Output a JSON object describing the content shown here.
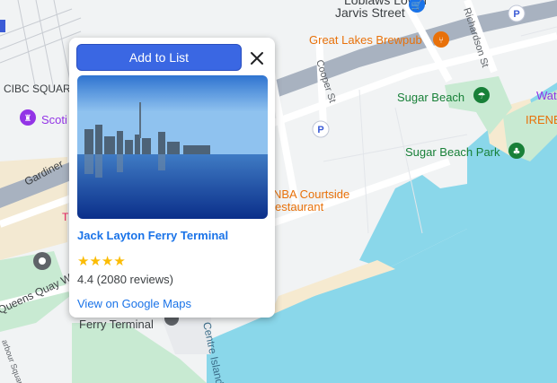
{
  "map": {
    "labels": {
      "loblaws": "Loblaws Lower",
      "jarvis": "Jarvis Street",
      "great_lakes": "Great Lakes Brewpub",
      "richardson": "Richardson St",
      "cooper": "Cooper St",
      "sugar_beach": "Sugar Beach",
      "sugar_beach_park": "Sugar Beach Park",
      "wat": "Wat",
      "irene": "IRENE",
      "cibc": "CIBC SQUAR",
      "scoti": "Scoti",
      "gardiner": "Gardiner",
      "courtside_1": "NBA Courtside",
      "courtside_2": "estaurant",
      "queens_quay": "Queens Quay W",
      "ferry_terminal": "Ferry Terminal",
      "centre_island": "Centre Island",
      "harbour_sq": "arbour Square",
      "t_letter": "T",
      "parking": "P"
    },
    "colors": {
      "water": "#8ad7ea",
      "land": "#f1f3f4",
      "road": "#ffffff",
      "highway": "#a8b2c0",
      "park": "#c8ead2",
      "sand": "#f6ead0",
      "poi_orange": "#e8710a",
      "poi_green": "#188038",
      "poi_purple": "#9334e6",
      "transit_label": "#3c4043"
    },
    "icons": [
      "shopping-cart-icon",
      "restaurant-icon",
      "beach-icon",
      "park-icon",
      "attraction-icon",
      "parking-icon",
      "ferry-pin-icon",
      "train-icon"
    ]
  },
  "popup": {
    "add_button": "Add to List",
    "close_icon": "close-icon",
    "title": "Jack Layton Ferry Terminal",
    "rating": 4.4,
    "stars_text": "★★★★",
    "reviews_text": "4.4 (2080 reviews)",
    "link": "View on Google Maps"
  }
}
